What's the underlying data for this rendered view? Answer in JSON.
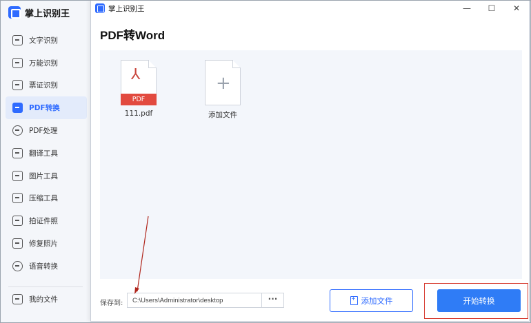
{
  "app": {
    "title": "掌上识别王",
    "sidebar": {
      "items": [
        {
          "label": "文字识别",
          "active": false
        },
        {
          "label": "万能识别",
          "active": false
        },
        {
          "label": "票证识别",
          "active": false
        },
        {
          "label": "PDF转换",
          "active": true
        },
        {
          "label": "PDF处理",
          "active": false
        },
        {
          "label": "翻译工具",
          "active": false
        },
        {
          "label": "图片工具",
          "active": false
        },
        {
          "label": "压缩工具",
          "active": false
        },
        {
          "label": "拍证件照",
          "active": false
        },
        {
          "label": "修复照片",
          "active": false
        },
        {
          "label": "语音转换",
          "active": false
        }
      ],
      "my_files": "我的文件"
    }
  },
  "dialog": {
    "title": "掌上识别王",
    "heading": "PDF转Word",
    "window_buttons": {
      "minimize": "—",
      "maximize": "☐",
      "close": "✕"
    },
    "files": [
      {
        "name": "111.pdf",
        "type_badge": "PDF"
      }
    ],
    "add_tile_label": "添加文件",
    "save_to_label": "保存到:",
    "save_path": "C:\\Users\\Administrator\\desktop",
    "browse_label": "···",
    "add_file_button": "添加文件",
    "start_button": "开始转换"
  },
  "colors": {
    "accent": "#2f7cf6",
    "pdf_red": "#e24a3f",
    "annotation_red": "#d6392e"
  }
}
